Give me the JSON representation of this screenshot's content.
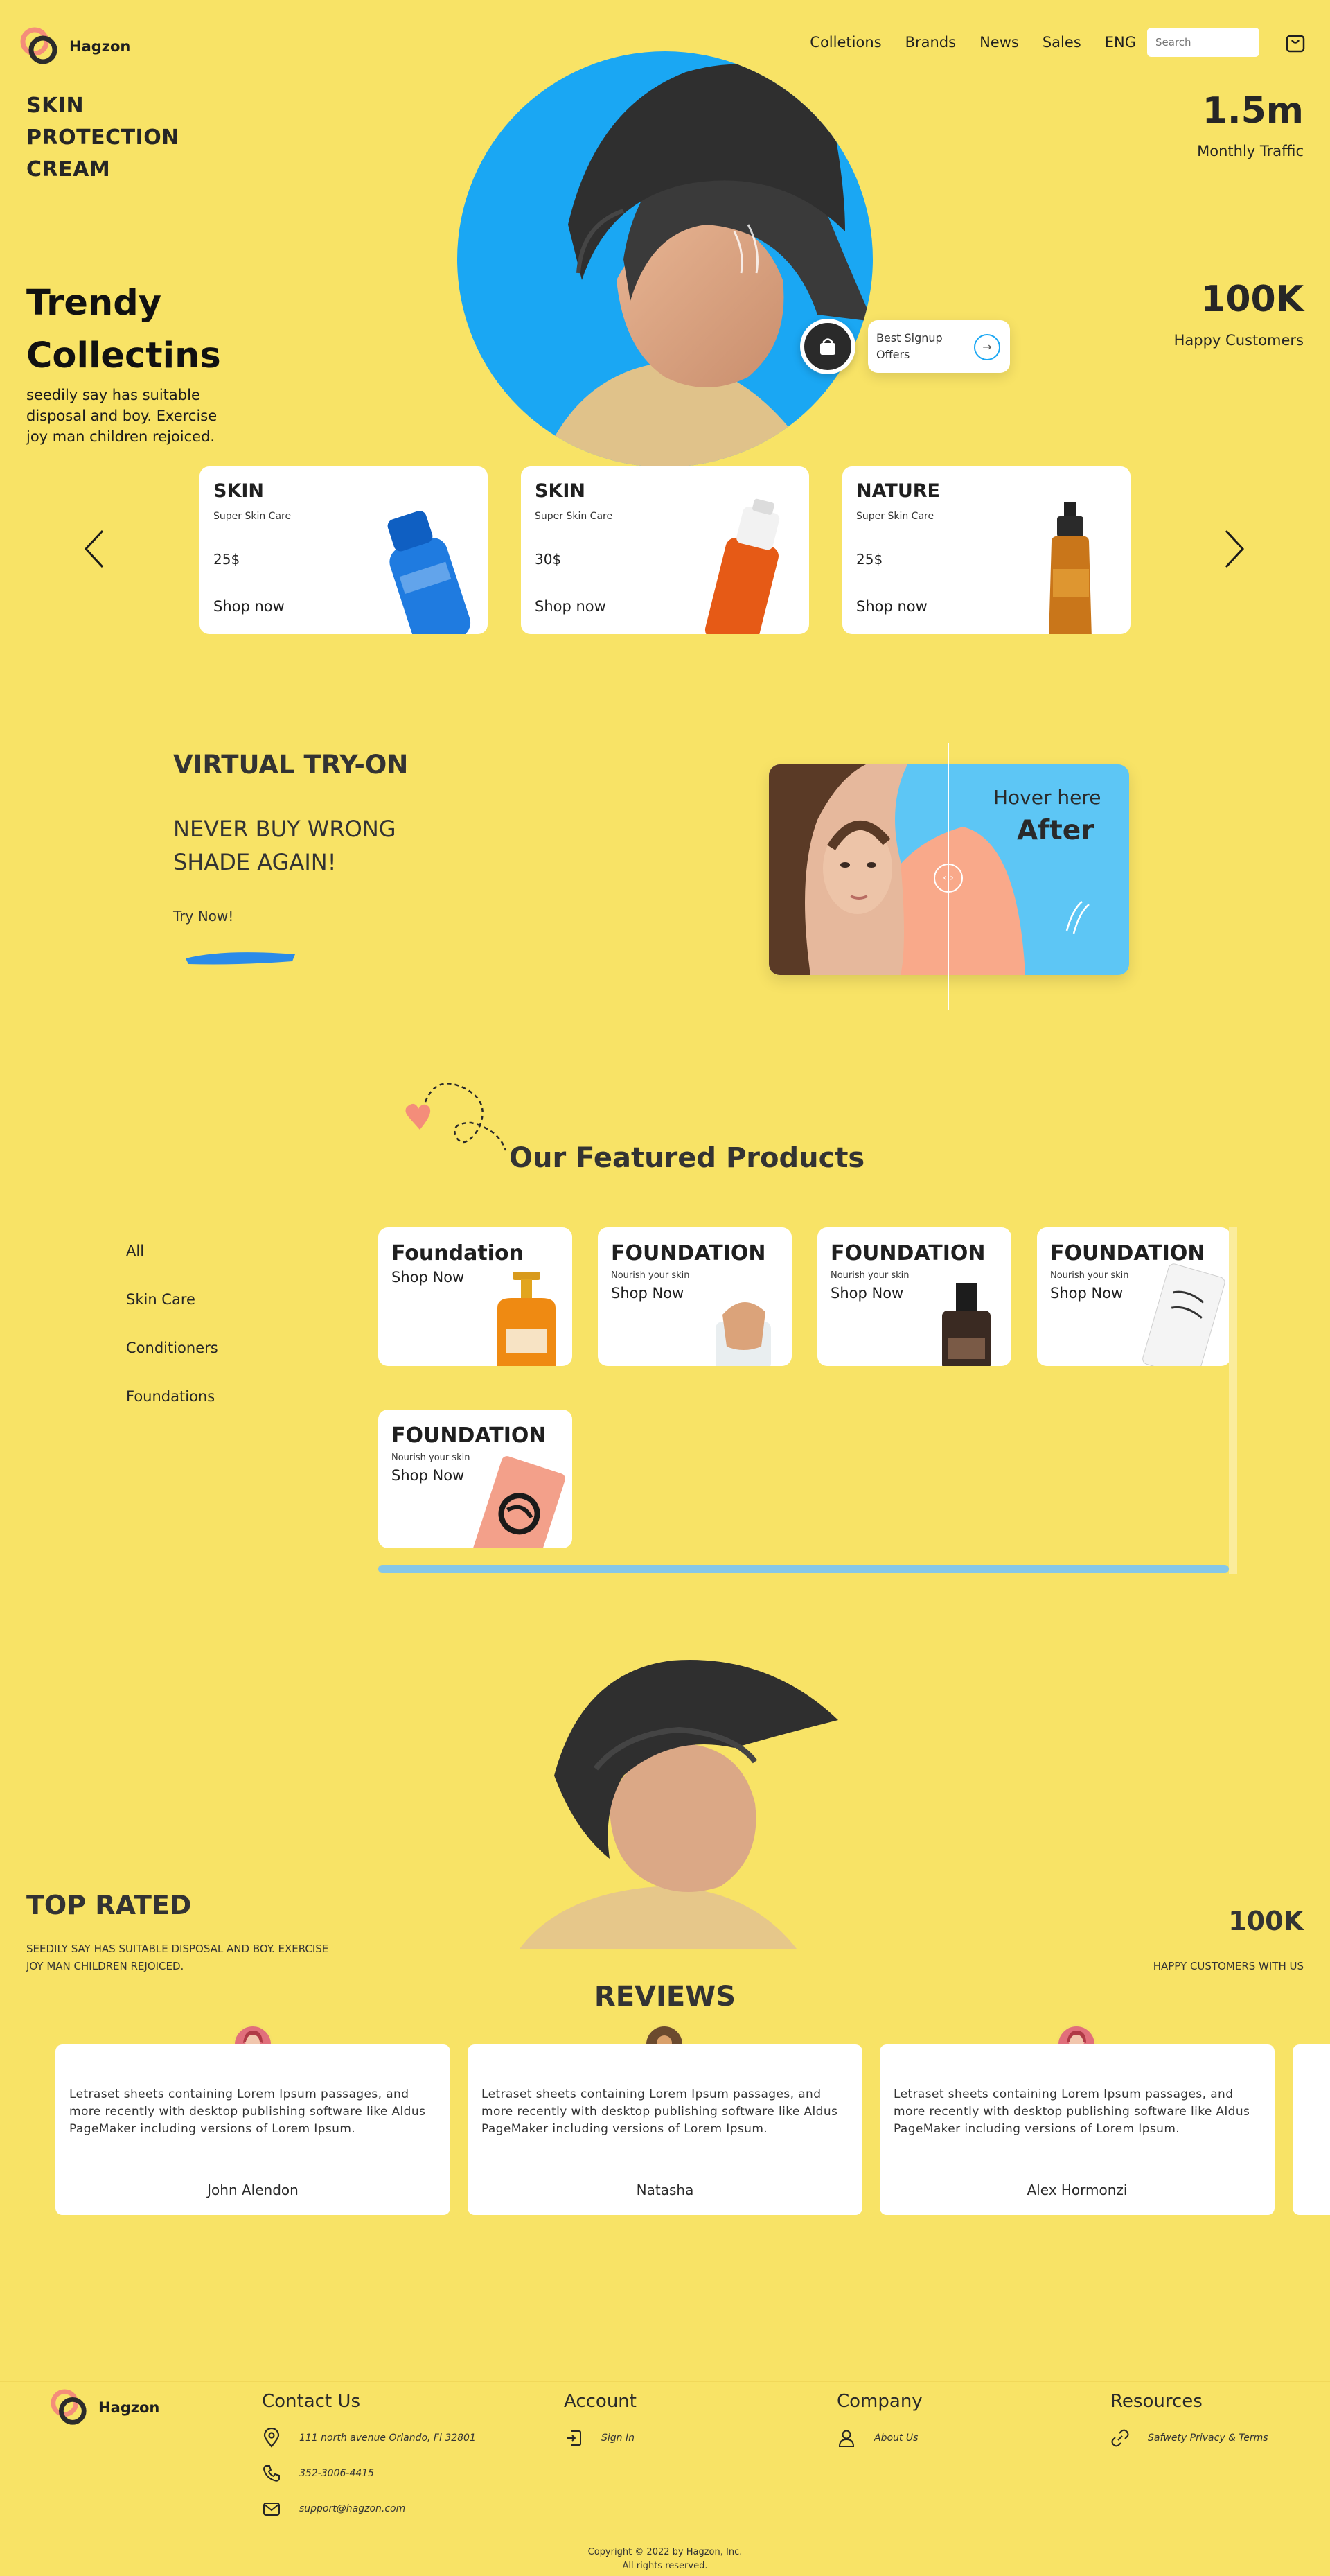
{
  "brand": {
    "name": "Hagzon"
  },
  "nav": {
    "links": [
      "Colletions",
      "Brands",
      "News",
      "Sales",
      "ENG"
    ],
    "search_placeholder": "Search"
  },
  "hero": {
    "tag_lines": [
      "SKIN",
      "PROTECTION",
      "CREAM"
    ],
    "title_lines": [
      "Trendy",
      "Collectins"
    ],
    "description": "seedily say has suitable disposal and boy. Exercise joy man children rejoiced.",
    "stats": [
      {
        "value": "1.5m",
        "label": "Monthly Traffic"
      },
      {
        "value": "100K",
        "label": "Happy Customers"
      }
    ],
    "signup": {
      "line1": "Best Signup",
      "line2": "Offers"
    }
  },
  "products": [
    {
      "name": "SKIN",
      "subtitle": "Super Skin Care",
      "price": "25$",
      "cta": "Shop now"
    },
    {
      "name": "SKIN",
      "subtitle": "Super Skin Care",
      "price": "30$",
      "cta": "Shop now"
    },
    {
      "name": "NATURE",
      "subtitle": "Super Skin Care",
      "price": "25$",
      "cta": "Shop now"
    }
  ],
  "virtual_try_on": {
    "title": "VIRTUAL TRY-ON",
    "subtitle_lines": [
      "NEVER BUY WRONG",
      "SHADE AGAIN!"
    ],
    "cta": "Try Now!",
    "hover_label": "Hover here",
    "after_label": "After"
  },
  "featured": {
    "title": "Our Featured Products",
    "categories": [
      "All",
      "Skin Care",
      "Conditioners",
      "Foundations"
    ],
    "items": [
      {
        "name": "Foundation",
        "subtitle": "",
        "cta": "Shop Now"
      },
      {
        "name": "FOUNDATION",
        "subtitle": "Nourish your skin",
        "cta": "Shop Now"
      },
      {
        "name": "FOUNDATION",
        "subtitle": "Nourish your skin",
        "cta": "Shop Now"
      },
      {
        "name": "FOUNDATION",
        "subtitle": "Nourish your skin",
        "cta": "Shop Now"
      },
      {
        "name": "FOUNDATION",
        "subtitle": "Nourish your skin",
        "cta": "Shop Now"
      }
    ]
  },
  "top_rated": {
    "title": "TOP RATED",
    "description": "SEEDILY SAY HAS SUITABLE DISPOSAL AND BOY. EXERCISE JOY MAN CHILDREN REJOICED.",
    "stat_value": "100K",
    "stat_label": "HAPPY CUSTOMERS WITH US"
  },
  "reviews": {
    "title": "REVIEWS",
    "items": [
      {
        "text": "Letraset sheets containing Lorem Ipsum passages, and more recently with desktop publishing software like Aldus PageMaker including versions of Lorem Ipsum.",
        "name": "John Alendon"
      },
      {
        "text": "Letraset sheets containing Lorem Ipsum passages, and more recently with desktop publishing software like Aldus PageMaker including versions of Lorem Ipsum.",
        "name": "Natasha"
      },
      {
        "text": "Letraset sheets containing Lorem Ipsum passages, and more recently with desktop publishing software like Aldus PageMaker including versions of Lorem Ipsum.",
        "name": "Alex Hormonzi"
      }
    ]
  },
  "footer": {
    "contact": {
      "heading": "Contact Us",
      "address": "111 north avenue Orlando, Fl 32801",
      "phone": "352-3006-4415",
      "email": "support@hagzon.com"
    },
    "account": {
      "heading": "Account",
      "item": "Sign In"
    },
    "company": {
      "heading": "Company",
      "item": "About Us"
    },
    "resources": {
      "heading": "Resources",
      "item": "Safwety Privacy & Terms"
    },
    "copyright_line1": "Copyright © 2022 by Hagzon, Inc.",
    "copyright_line2": "All rights reserved."
  },
  "colors": {
    "background": "#f8e366",
    "accent_blue": "#1aa7f3",
    "accent_peach": "#f9a98a",
    "dark": "#262626"
  }
}
